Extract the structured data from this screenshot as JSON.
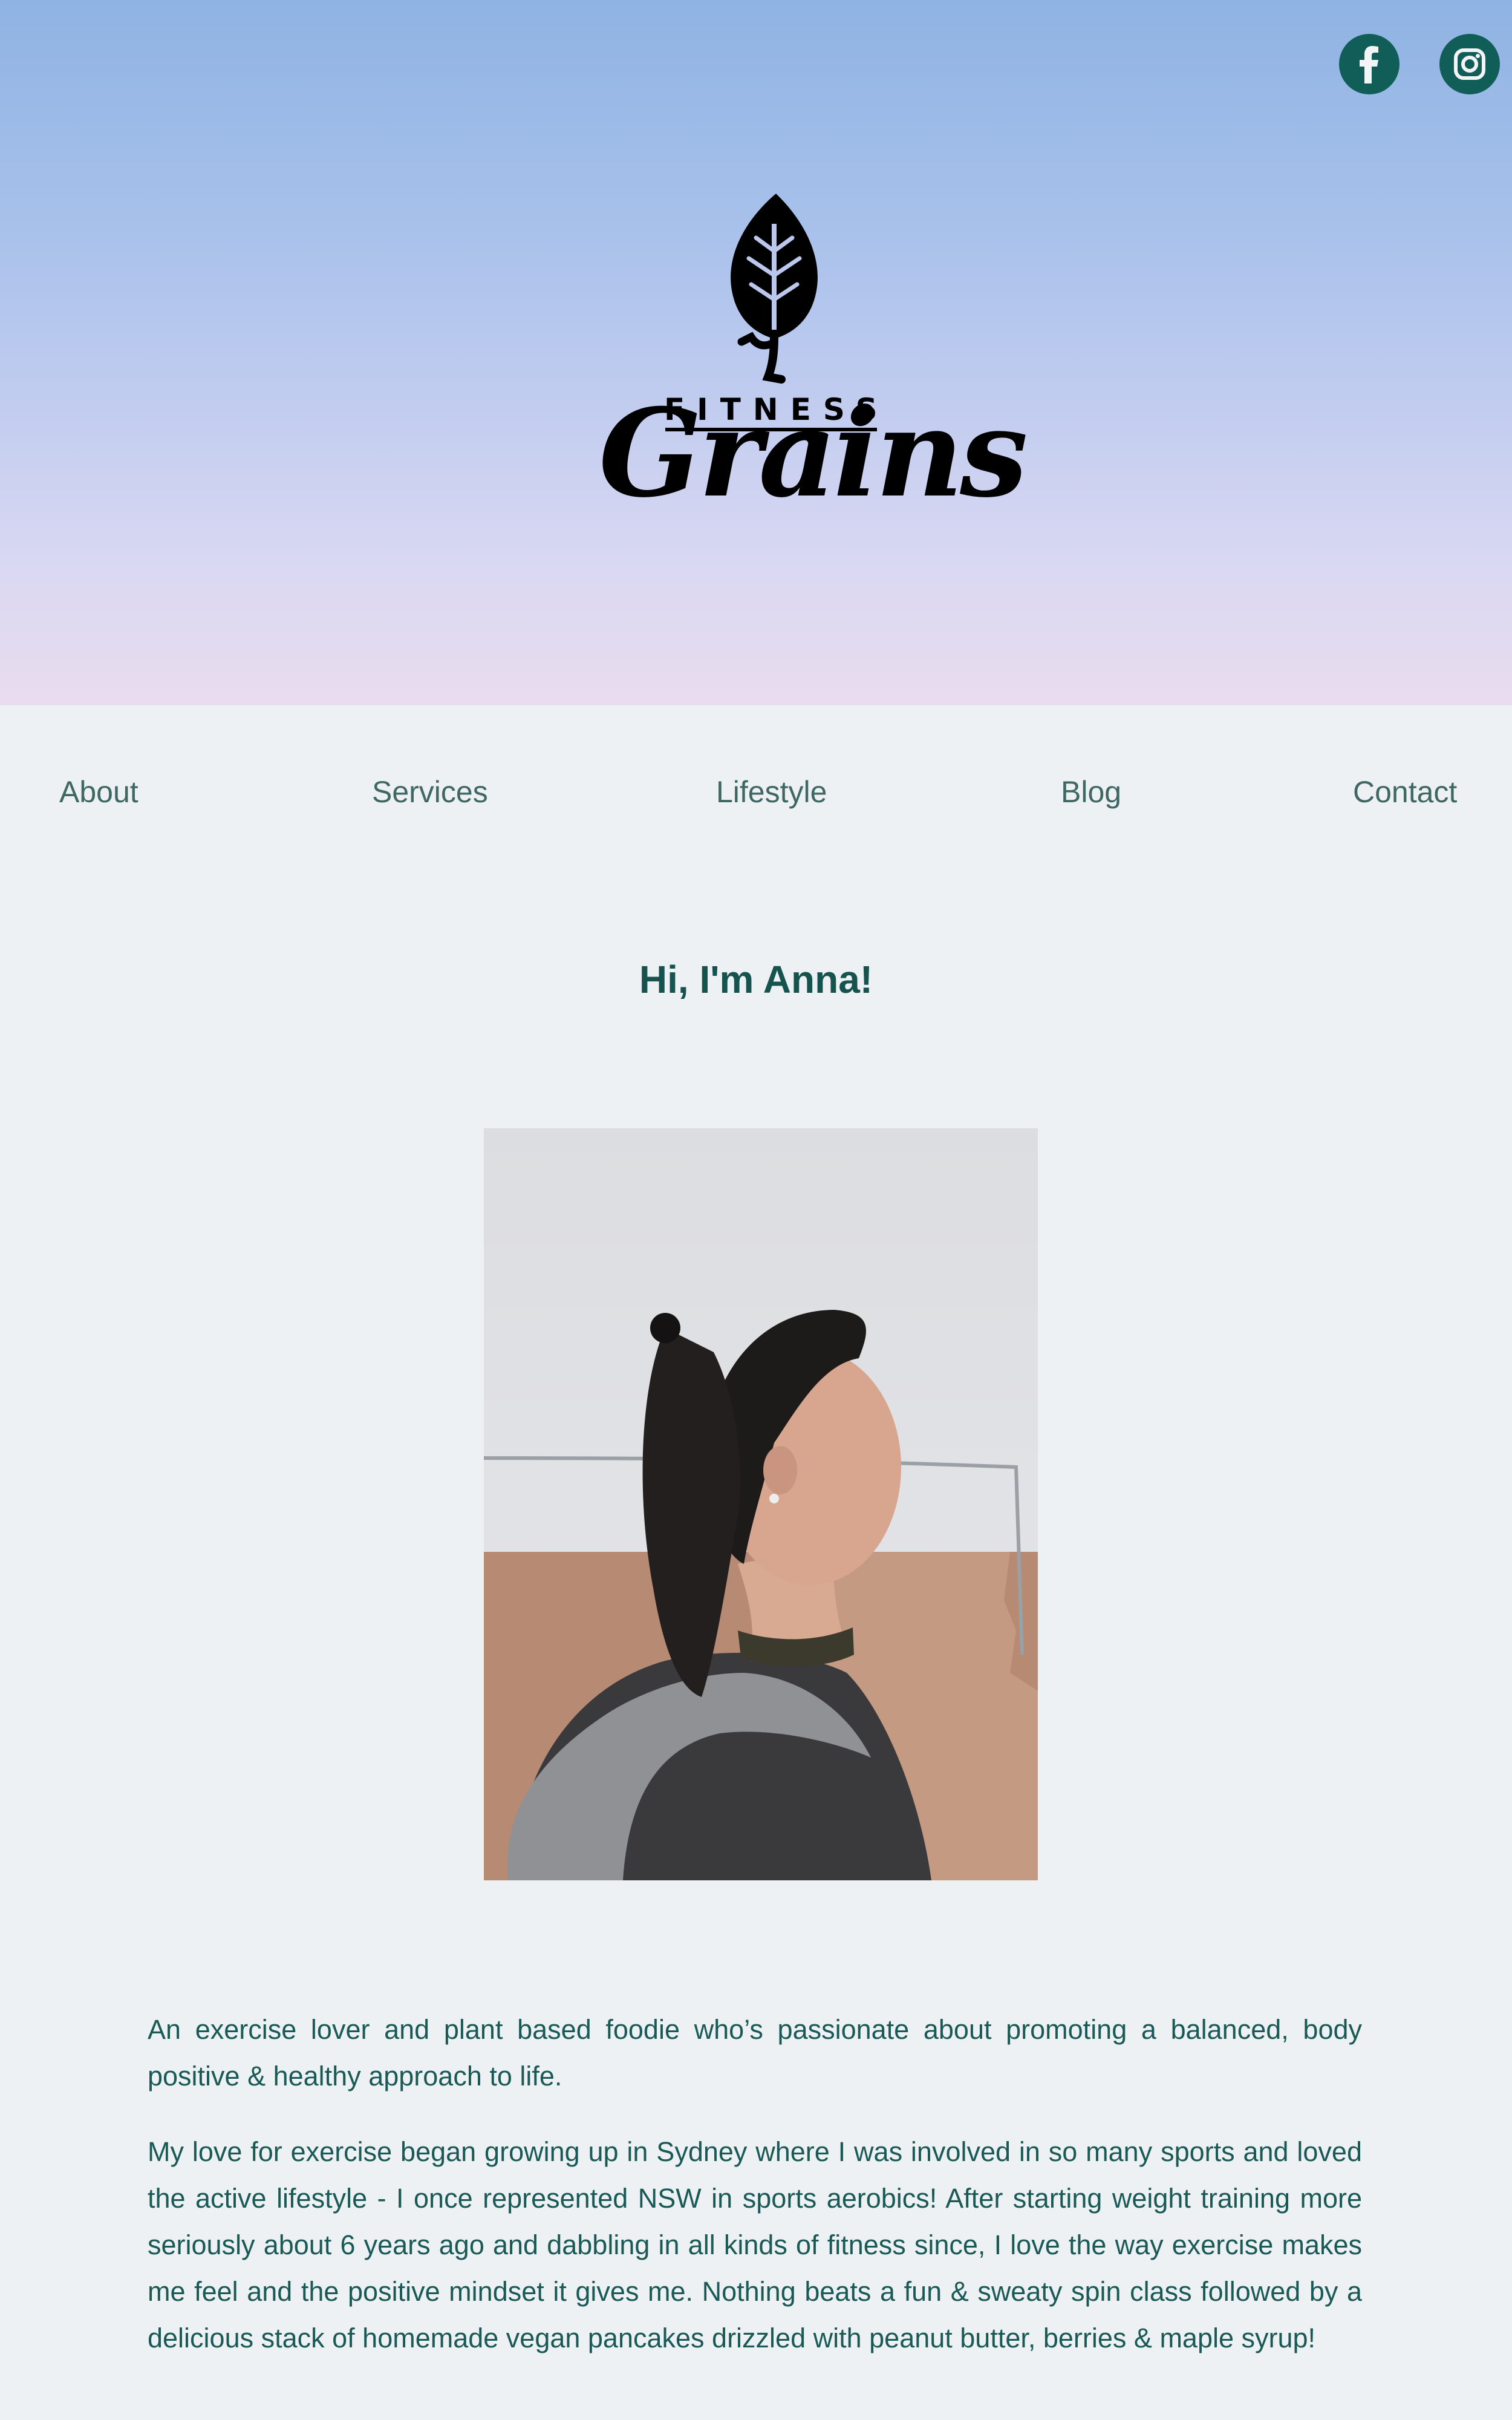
{
  "social": {
    "facebook_icon": "facebook-icon",
    "instagram_icon": "instagram-icon",
    "color": "#115e59"
  },
  "brand": {
    "logo_top_text": "FITNESS",
    "logo_script_text": "Grains",
    "logo_icon": "leaf-icon"
  },
  "nav": {
    "items": [
      {
        "label": "About"
      },
      {
        "label": "Services"
      },
      {
        "label": "Lifestyle"
      },
      {
        "label": "Blog"
      },
      {
        "label": "Contact"
      }
    ]
  },
  "main": {
    "heading": "Hi, I'm Anna!",
    "paragraphs": [
      "An exercise lover and plant based foodie who’s passionate about promoting a balanced, body positive & healthy approach to life.",
      "My love for exercise began growing up in Sydney where I was involved in so many sports and loved the active lifestyle - I once represented NSW in sports aerobics! After starting weight training more seriously about 6 years ago and dabbling in all kinds of fitness since, I love the way exercise makes me feel and the positive mindset it gives me. Nothing beats a fun & sweaty spin class followed by a delicious stack of homemade vegan pancakes drizzled with peanut butter, berries & maple syrup!"
    ]
  },
  "colors": {
    "accent": "#115e59",
    "nav_text": "#3f6764",
    "body_text": "#1a5a56",
    "page_bg": "#eef1f4"
  }
}
